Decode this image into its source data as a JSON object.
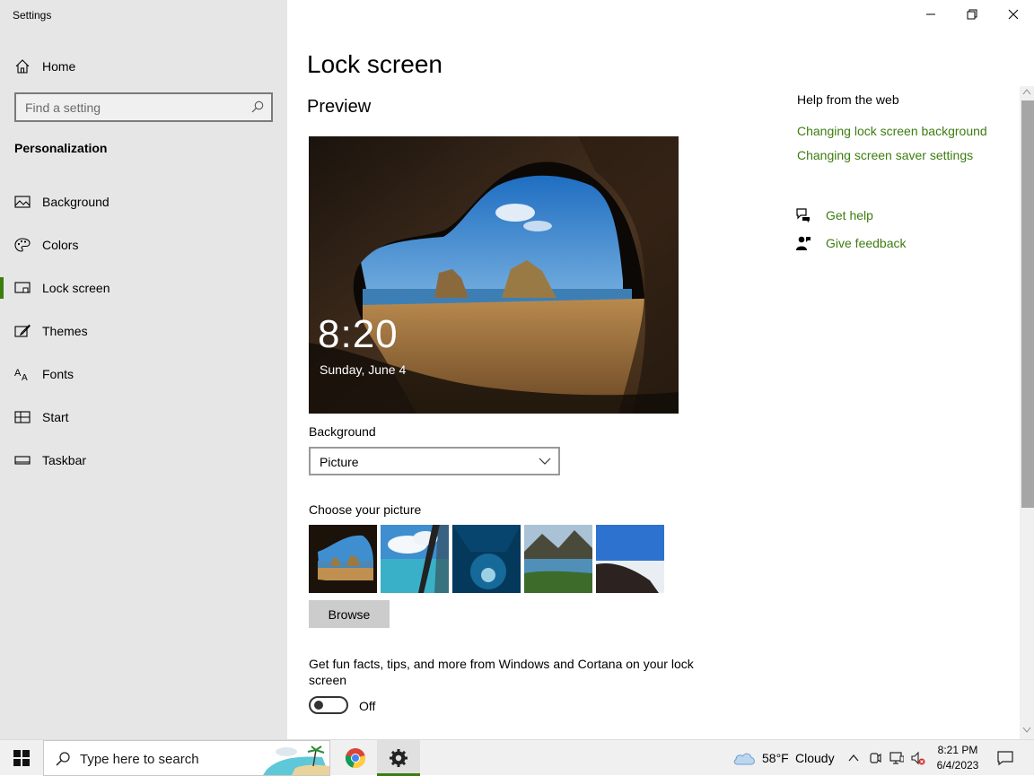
{
  "window": {
    "app_title": "Settings",
    "controls": {
      "minimize": "minimize-icon",
      "maximize": "restore-icon",
      "close": "close-icon"
    }
  },
  "sidebar": {
    "home_label": "Home",
    "search_placeholder": "Find a setting",
    "section_title": "Personalization",
    "items": [
      {
        "label": "Background",
        "icon": "picture-icon"
      },
      {
        "label": "Colors",
        "icon": "palette-icon"
      },
      {
        "label": "Lock screen",
        "icon": "lock-screen-icon",
        "active": true
      },
      {
        "label": "Themes",
        "icon": "brush-icon"
      },
      {
        "label": "Fonts",
        "icon": "font-icon"
      },
      {
        "label": "Start",
        "icon": "start-icon"
      },
      {
        "label": "Taskbar",
        "icon": "taskbar-icon"
      }
    ]
  },
  "main": {
    "page_title": "Lock screen",
    "preview_label": "Preview",
    "preview_time": "8:20",
    "preview_date": "Sunday, June 4",
    "background_label": "Background",
    "background_value": "Picture",
    "choose_label": "Choose your picture",
    "browse_label": "Browse",
    "tips_text": "Get fun facts, tips, and more from Windows and Cortana on your lock screen",
    "tips_toggle_state": "Off"
  },
  "help": {
    "title": "Help from the web",
    "links": [
      "Changing lock screen background",
      "Changing screen saver settings"
    ],
    "get_help": "Get help",
    "give_feedback": "Give feedback"
  },
  "taskbar": {
    "search_placeholder": "Type here to search",
    "weather_temp": "58°F",
    "weather_condition": "Cloudy",
    "time": "8:21 PM",
    "date": "6/4/2023"
  },
  "colors": {
    "accent": "#3c7d0f",
    "sidebar_bg": "#e6e6e6",
    "taskbar_bg": "#f0f0f0"
  }
}
